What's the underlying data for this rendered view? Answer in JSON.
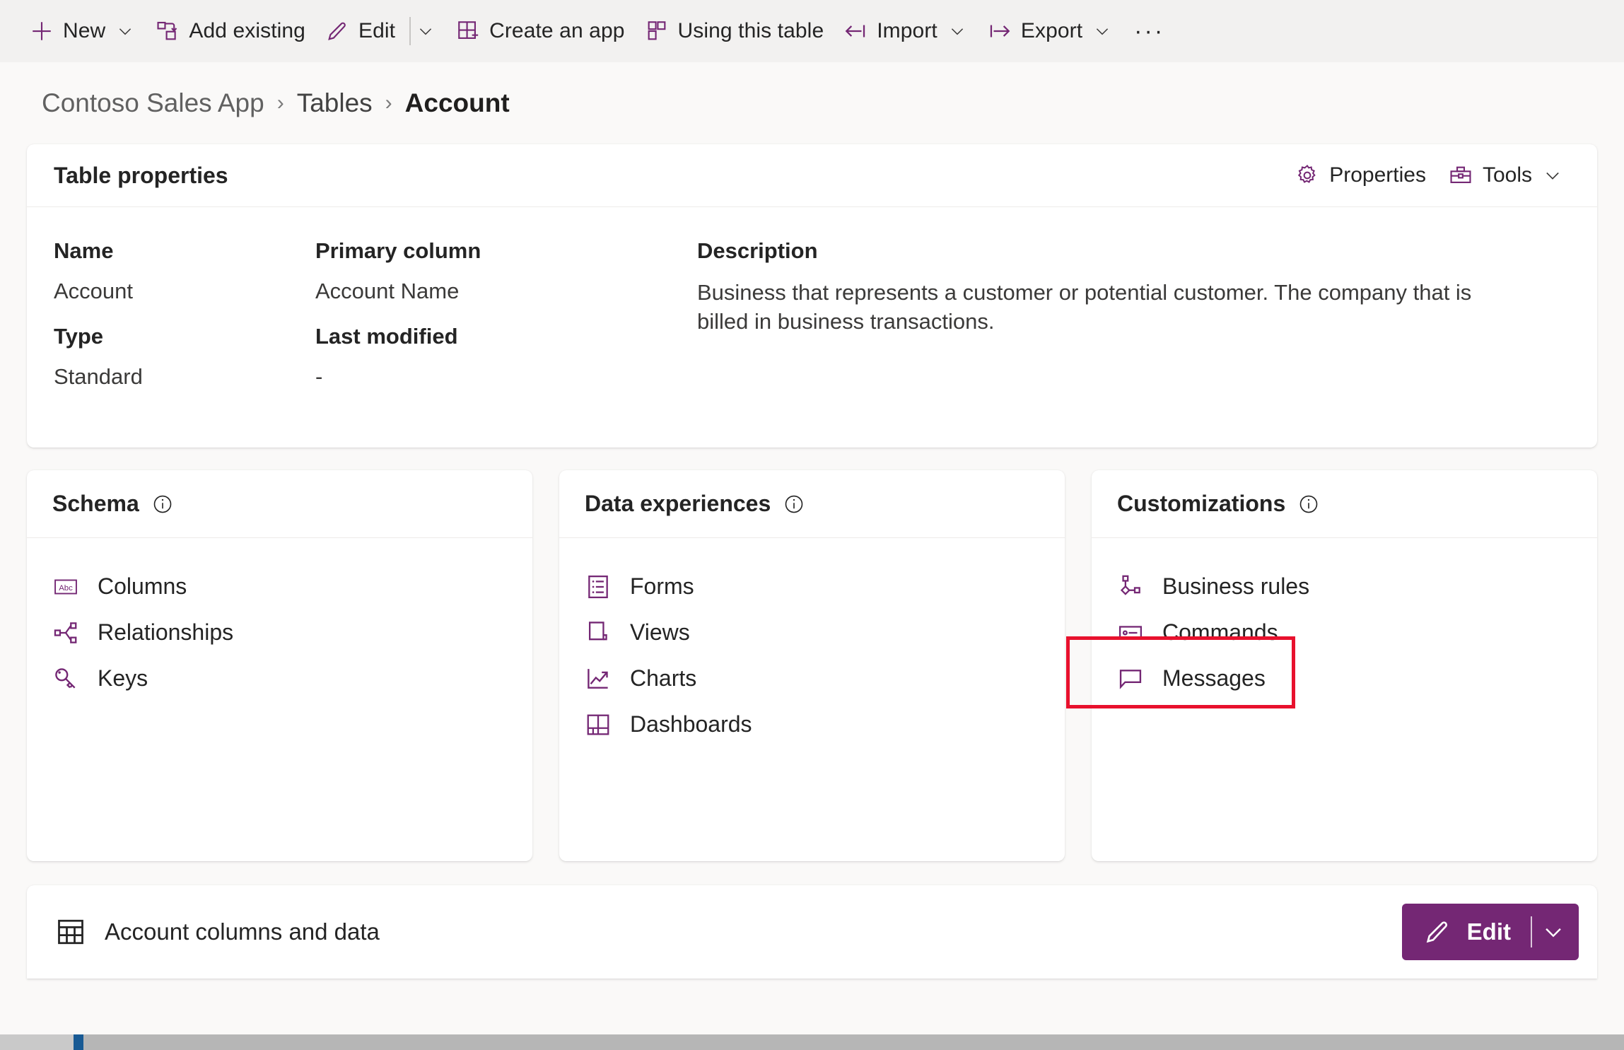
{
  "colors": {
    "brand_purple": "#742774",
    "highlight_red": "#e8112d",
    "page_bg": "#faf9f8",
    "commandbar_bg": "#f2f1f0",
    "card_bg": "#ffffff"
  },
  "commandbar": {
    "items": [
      {
        "label": "New",
        "icon": "plus-icon",
        "has_caret": true
      },
      {
        "label": "Add existing",
        "icon": "add-existing-icon",
        "has_caret": false
      },
      {
        "label": "Edit",
        "icon": "pencil-icon",
        "has_caret": true
      },
      {
        "label": "Create an app",
        "icon": "create-app-icon",
        "has_caret": false
      },
      {
        "label": "Using this table",
        "icon": "using-table-icon",
        "has_caret": false
      },
      {
        "label": "Import",
        "icon": "import-icon",
        "has_caret": true
      },
      {
        "label": "Export",
        "icon": "export-icon",
        "has_caret": true
      }
    ],
    "overflow_label": "···"
  },
  "breadcrumb": {
    "separator": "›",
    "items": [
      {
        "label": "Contoso Sales App"
      },
      {
        "label": "Tables"
      },
      {
        "label": "Account"
      }
    ]
  },
  "table_properties": {
    "title": "Table properties",
    "actions": [
      {
        "label": "Properties",
        "icon": "gear-icon",
        "has_caret": false
      },
      {
        "label": "Tools",
        "icon": "toolbox-icon",
        "has_caret": true
      }
    ],
    "fields": {
      "name_label": "Name",
      "name_value": "Account",
      "type_label": "Type",
      "type_value": "Standard",
      "primary_column_label": "Primary column",
      "primary_column_value": "Account Name",
      "last_modified_label": "Last modified",
      "last_modified_value": "-",
      "description_label": "Description",
      "description_value": "Business that represents a customer or potential customer. The company that is billed in business transactions."
    }
  },
  "cards": [
    {
      "title": "Schema",
      "info_icon": "info-icon",
      "links": [
        {
          "label": "Columns",
          "icon": "abc-icon",
          "highlighted": false
        },
        {
          "label": "Relationships",
          "icon": "relationships-icon",
          "highlighted": false
        },
        {
          "label": "Keys",
          "icon": "key-icon",
          "highlighted": false
        }
      ]
    },
    {
      "title": "Data experiences",
      "info_icon": "info-icon",
      "links": [
        {
          "label": "Forms",
          "icon": "form-icon",
          "highlighted": false
        },
        {
          "label": "Views",
          "icon": "view-icon",
          "highlighted": false
        },
        {
          "label": "Charts",
          "icon": "chart-icon",
          "highlighted": false
        },
        {
          "label": "Dashboards",
          "icon": "dashboard-icon",
          "highlighted": false
        }
      ]
    },
    {
      "title": "Customizations",
      "info_icon": "info-icon",
      "links": [
        {
          "label": "Business rules",
          "icon": "business-rules-icon",
          "highlighted": false
        },
        {
          "label": "Commands",
          "icon": "commands-icon",
          "highlighted": false
        },
        {
          "label": "Messages",
          "icon": "message-icon",
          "highlighted": true
        }
      ]
    }
  ],
  "bottom_section": {
    "title": "Account columns and data",
    "icon": "table-grid-icon",
    "edit_button": {
      "label": "Edit",
      "icon": "pencil-icon",
      "caret": "chevron-down-icon"
    }
  }
}
